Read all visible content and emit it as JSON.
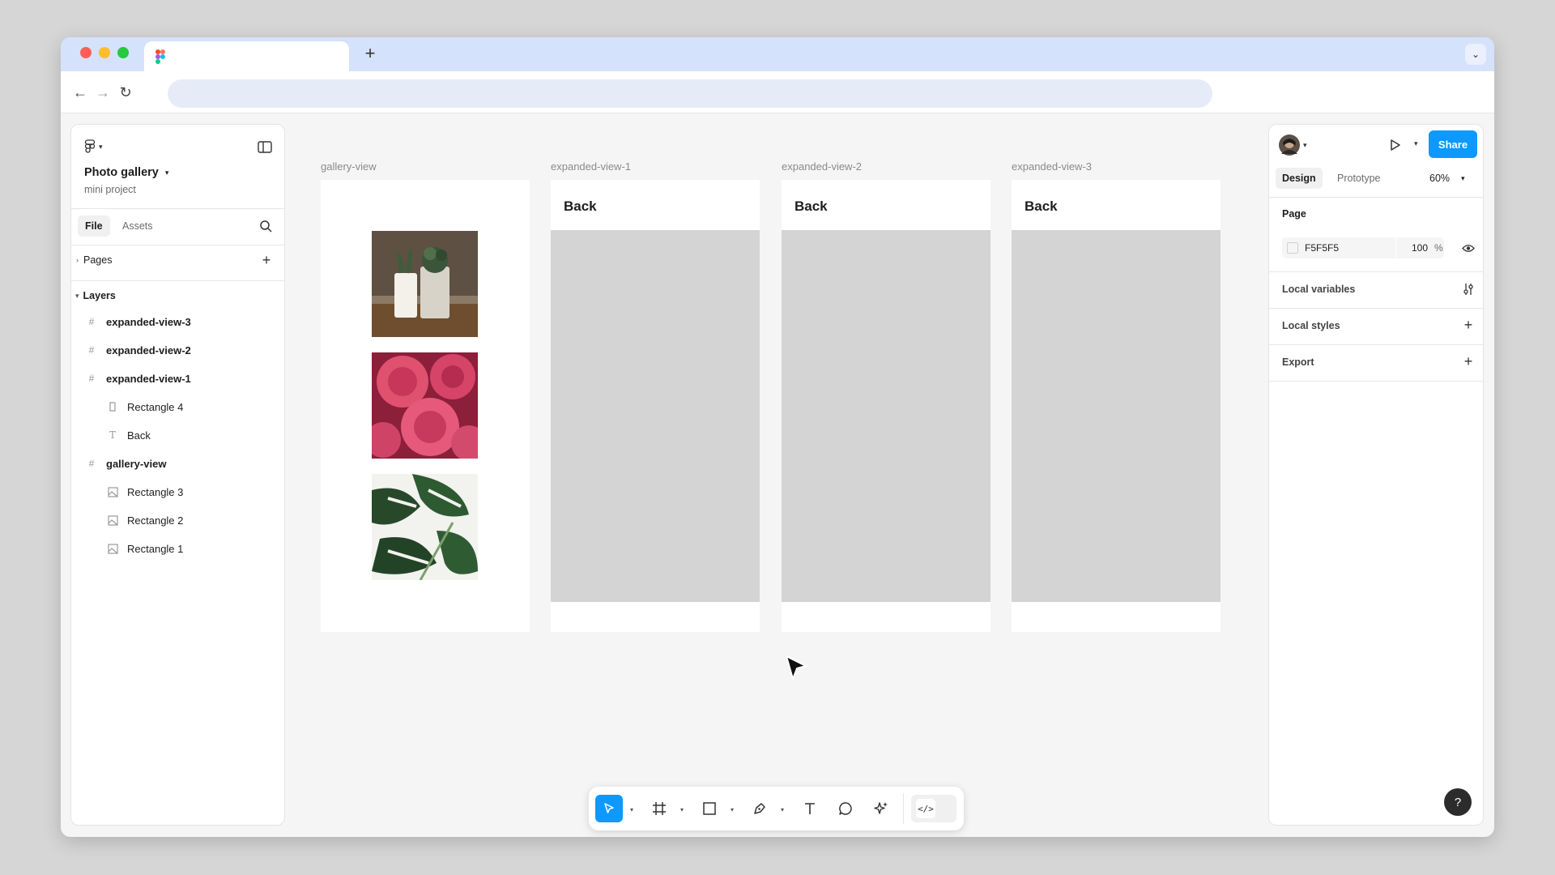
{
  "file": {
    "name": "Photo gallery",
    "project": "mini project"
  },
  "left_tabs": {
    "file": "File",
    "assets": "Assets"
  },
  "sections": {
    "pages": "Pages",
    "layers": "Layers"
  },
  "layers": [
    {
      "name": "expanded-view-3",
      "type": "frame",
      "indent": 0
    },
    {
      "name": "expanded-view-2",
      "type": "frame",
      "indent": 0
    },
    {
      "name": "expanded-view-1",
      "type": "frame",
      "indent": 0
    },
    {
      "name": "Rectangle 4",
      "type": "rectangle",
      "indent": 1
    },
    {
      "name": "Back",
      "type": "text",
      "indent": 1
    },
    {
      "name": "gallery-view",
      "type": "frame",
      "indent": 0
    },
    {
      "name": "Rectangle 3",
      "type": "image",
      "indent": 1
    },
    {
      "name": "Rectangle 2",
      "type": "image",
      "indent": 1
    },
    {
      "name": "Rectangle 1",
      "type": "image",
      "indent": 1
    }
  ],
  "canvas": {
    "frames": [
      {
        "label": "gallery-view"
      },
      {
        "label": "expanded-view-1",
        "title": "Back"
      },
      {
        "label": "expanded-view-2",
        "title": "Back"
      },
      {
        "label": "expanded-view-3",
        "title": "Back"
      }
    ]
  },
  "right_panel": {
    "tabs": {
      "design": "Design",
      "prototype": "Prototype"
    },
    "zoom": "60%",
    "share_label": "Share",
    "page": {
      "title": "Page",
      "color_hex": "F5F5F5",
      "opacity": "100",
      "percent": "%"
    },
    "local_variables": "Local variables",
    "local_styles": "Local styles",
    "export": "Export"
  },
  "colors": {
    "accent": "#0d99ff",
    "page_background": "#F5F5F5",
    "traffic_red": "#ff5f57",
    "traffic_yellow": "#febc2e",
    "traffic_green": "#28c840"
  },
  "help_label": "?"
}
